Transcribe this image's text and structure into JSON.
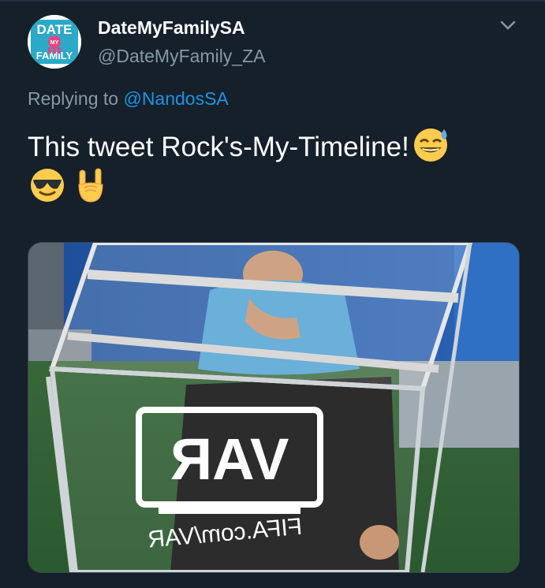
{
  "account": {
    "display_name": "DateMyFamilySA  ",
    "handle": "@DateMyFamily_ZA",
    "avatar_text": "DATE MY FAMILY"
  },
  "reply": {
    "prefix": "Replying to ",
    "mention": "@NandosSA"
  },
  "tweet": {
    "text": "This tweet Rock's-My-Timeline!"
  },
  "media": {
    "sign_text": "VAR",
    "url_text": "FIFA.com/VAR"
  },
  "colors": {
    "background": "#15202b",
    "link": "#1b95e0",
    "secondary_text": "#8899a6",
    "border": "#38444d"
  },
  "icons": [
    "chevron-down-icon",
    "sweat-smile-emoji-icon",
    "sunglasses-emoji-icon",
    "rock-on-hand-emoji-icon"
  ]
}
